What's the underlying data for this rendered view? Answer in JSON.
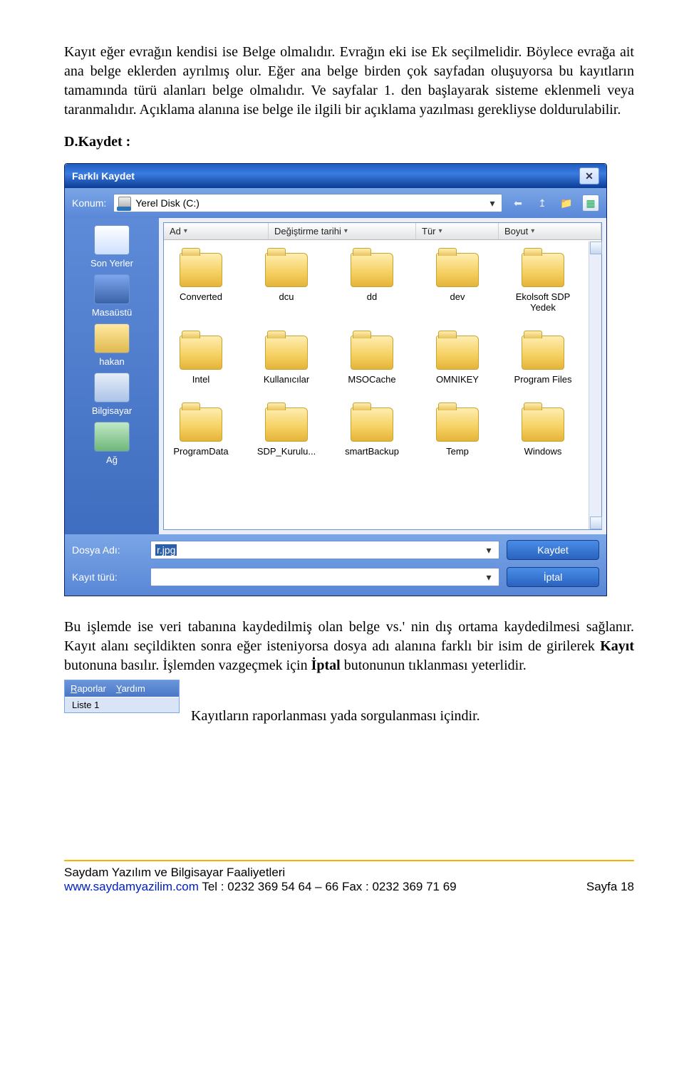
{
  "paragraph1": "Kayıt eğer evrağın kendisi ise Belge olmalıdır. Evrağın eki ise Ek seçilmelidir. Böylece evrağa ait ana belge eklerden ayrılmış olur. Eğer ana belge birden çok sayfadan oluşuyorsa bu kayıtların tamamında türü alanları belge olmalıdır. Ve sayfalar 1. den başlayarak sisteme eklenmeli veya taranmalıdır. Açıklama alanına ise belge ile ilgili bir açıklama yazılması gerekliyse doldurulabilir.",
  "sectionHead": "D.Kaydet :",
  "dialog": {
    "title": "Farklı Kaydet",
    "konumLabel": "Konum:",
    "konumValue": "Yerel Disk (C:)",
    "cols": {
      "name": "Ad",
      "date": "Değiştirme tarihi",
      "type": "Tür",
      "size": "Boyut"
    },
    "side": [
      "Son Yerler",
      "Masaüstü",
      "hakan",
      "Bilgisayar",
      "Ağ"
    ],
    "folders": [
      "Converted",
      "dcu",
      "dd",
      "dev",
      "Ekolsoft SDP Yedek",
      "Intel",
      "Kullanıcılar",
      "MSOCache",
      "OMNIKEY",
      "Program Files",
      "ProgramData",
      "SDP_Kurulu...",
      "smartBackup",
      "Temp",
      "Windows"
    ],
    "fileLabel": "Dosya Adı:",
    "fileValue": "r.jpg",
    "typeLabel": "Kayıt türü:",
    "saveBtn": "Kaydet",
    "cancelBtn": "İptal"
  },
  "paragraph2a": "Bu işlemde ise veri tabanına kaydedilmiş olan belge vs.' nin dış ortama kaydedilmesi sağlanır. Kayıt alanı seçildikten sonra eğer isteniyorsa dosya adı alanına farklı bir isim de girilerek ",
  "paragraph2_bold1": "Kayıt",
  "paragraph2b": " butonuna basılır. İşlemden vazgeçmek için ",
  "paragraph2_bold2": "İptal",
  "paragraph2c": " butonunun tıklanması yeterlidir.",
  "toolbar": {
    "menu1": "Raporlar",
    "menu2": "Yardım",
    "tab": "Liste 1"
  },
  "toolbarCaption": "Kayıtların raporlanması yada sorgulanması içindir.",
  "footer": {
    "line1": "Saydam Yazılım ve Bilgisayar Faaliyetleri",
    "site": "www.saydamyazilim.com",
    "phones": " Tel  : 0232 369 54 64 – 66 Fax : 0232 369 71 69",
    "page": "Sayfa 18"
  }
}
